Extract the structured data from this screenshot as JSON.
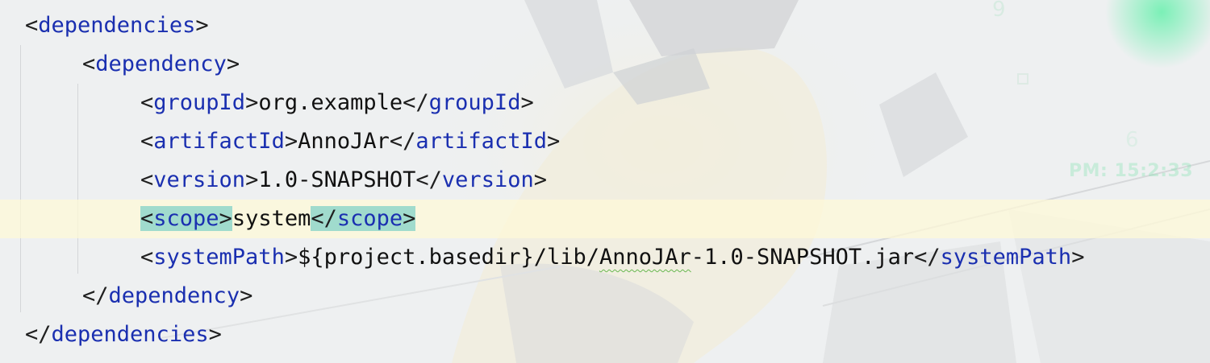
{
  "editor": {
    "language": "xml",
    "lines": [
      {
        "open_tag": "dependencies",
        "indent": 0
      },
      {
        "open_tag": "dependency",
        "indent": 1
      },
      {
        "tag": "groupId",
        "value": "org.example",
        "indent": 2
      },
      {
        "tag": "artifactId",
        "value": "AnnoJAr",
        "indent": 2
      },
      {
        "tag": "version",
        "value": "1.0-SNAPSHOT",
        "indent": 2
      },
      {
        "tag": "scope",
        "value": "system",
        "indent": 2,
        "current_line": true,
        "tag_highlighted": true
      },
      {
        "tag": "systemPath",
        "value_pre": "${project.basedir}/lib/",
        "value_flagged": "AnnoJAr",
        "value_post": "-1.0-SNAPSHOT.jar",
        "indent": 2
      },
      {
        "close_tag": "dependency",
        "indent": 1
      },
      {
        "close_tag": "dependencies",
        "indent": 0
      }
    ],
    "colors": {
      "tag_name": "#1a2fb0",
      "punctuation": "#1f1f1f",
      "text": "#111111",
      "current_line": "#fffad7",
      "tag_match_highlight": "#56c4bf",
      "spellcheck_underline": "#67b84f"
    }
  },
  "wallpaper": {
    "clock_text": "PM: 15:2:33",
    "clock_color": "#82e1af"
  }
}
